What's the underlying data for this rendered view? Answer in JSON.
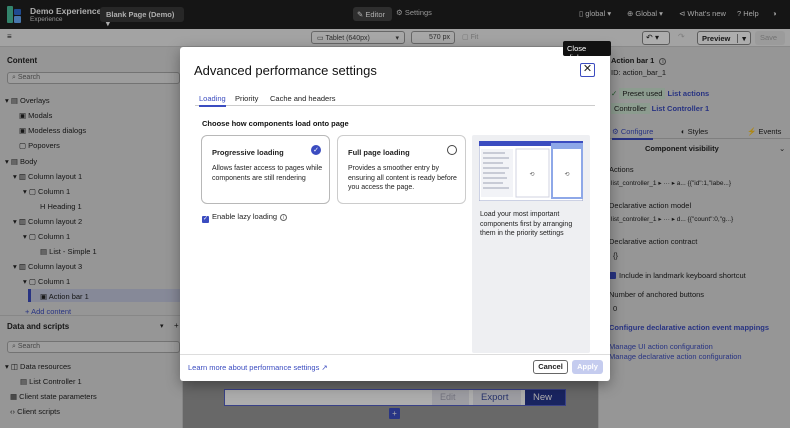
{
  "topbar": {
    "app_title": "Demo Experience",
    "app_subtitle": "Experience",
    "page_select": "Blank Page (Demo)",
    "editor_label": "Editor",
    "settings_label": "Settings",
    "global_scope": "global",
    "global_lang": "Global",
    "whats_new": "What's new",
    "help": "Help"
  },
  "toolbar": {
    "device": "Tablet (640px)",
    "width_value": "570",
    "width_unit": "px",
    "fit_label": "Fit",
    "preview_label": "Preview",
    "save_label": "Save"
  },
  "left_panel": {
    "content_title": "Content",
    "search_placeholder": "Search",
    "tree": [
      {
        "label": "Overlays"
      },
      {
        "label": "Modals"
      },
      {
        "label": "Modeless dialogs"
      },
      {
        "label": "Popovers"
      },
      {
        "label": "Body"
      },
      {
        "label": "Column layout 1"
      },
      {
        "label": "Column 1"
      },
      {
        "label": "Heading 1"
      },
      {
        "label": "Column layout 2"
      },
      {
        "label": "Column 1"
      },
      {
        "label": "List - Simple 1"
      },
      {
        "label": "Column layout 3"
      },
      {
        "label": "Column 1"
      },
      {
        "label": "Action bar 1"
      },
      {
        "label": "Add content"
      }
    ],
    "data_title": "Data and scripts",
    "data_search_placeholder": "Search",
    "data_tree": [
      {
        "label": "Data resources"
      },
      {
        "label": "List Controller 1"
      },
      {
        "label": "Client state parameters"
      },
      {
        "label": "Client scripts"
      }
    ]
  },
  "canvas": {
    "edit_label": "Edit",
    "export_label": "Export",
    "new_label": "New"
  },
  "right_panel": {
    "title": "Action bar 1",
    "id_line": "ID: action_bar_1",
    "preset_label": "Preset used",
    "preset_value": "List actions",
    "controller_label": "Controller",
    "controller_value": "List Controller 1",
    "tab_configure": "Configure",
    "tab_styles": "Styles",
    "tab_events": "Events",
    "section_title": "Component visibility",
    "actions_label": "Actions",
    "actions_value": "list_controller_1 ▸ ··· ▸ a... {{\"id\":1,\"labe...}",
    "model_label": "Declarative action model",
    "model_value": "list_controller_1 ▸ ··· ▸ d... {{\"count\":0,\"g...}",
    "contract_label": "Declarative action contract",
    "contract_value": "{}",
    "landmark_label": "Include in landmark keyboard shortcut",
    "anchored_label": "Number of anchored buttons",
    "anchored_value": "0",
    "configure_link": "Configure declarative action event mappings",
    "manage_ui_link": "Manage UI action configuration",
    "manage_decl_link": "Manage declarative action configuration"
  },
  "dialog": {
    "title": "Advanced performance settings",
    "close_tooltip": "Close dialog",
    "tabs": [
      {
        "label": "Loading",
        "active": true
      },
      {
        "label": "Priority",
        "active": false
      },
      {
        "label": "Cache and headers",
        "active": false
      }
    ],
    "subheading": "Choose how components load onto page",
    "options": [
      {
        "title": "Progressive loading",
        "desc": "Allows faster access to pages while components are still rendering",
        "selected": true
      },
      {
        "title": "Full page loading",
        "desc": "Provides a smoother entry by ensuring all content is ready before you access the page.",
        "selected": false
      }
    ],
    "lazy_label": "Enable lazy loading",
    "lazy_checked": true,
    "preview_text": "Load your most important components first by arranging them in the priority settings",
    "learn_more": "Learn more about performance settings",
    "cancel_label": "Cancel",
    "apply_label": "Apply"
  },
  "colors": {
    "accent": "#3b4cc0",
    "topbar": "#1f1f1f"
  }
}
